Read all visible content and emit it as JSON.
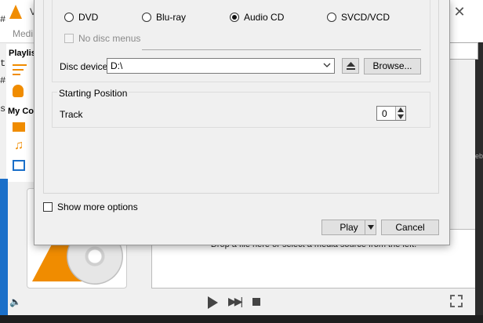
{
  "background_window": {
    "title": "V",
    "menu_text": "Medi",
    "sidebar": {
      "playlist_label": "Playlis",
      "my_computer_label": "My Co"
    },
    "left_edge_text": [
      "#",
      "t",
      "#",
      "s"
    ],
    "drop_hint": "Drop a file here or select a media source from the left.",
    "right_edge_text": "eb"
  },
  "dialog": {
    "disc_selection": {
      "options": [
        {
          "label": "DVD",
          "selected": false
        },
        {
          "label": "Blu-ray",
          "selected": false
        },
        {
          "label": "Audio CD",
          "selected": true
        },
        {
          "label": "SVCD/VCD",
          "selected": false
        }
      ],
      "no_disc_menus_label": "No disc menus",
      "disc_device_label": "Disc device",
      "disc_device_value": "D:\\",
      "browse_label": "Browse..."
    },
    "starting_position": {
      "legend": "Starting Position",
      "track_label": "Track",
      "track_value": "0"
    },
    "show_more_options_label": "Show more options",
    "play_label": "Play",
    "cancel_label": "Cancel"
  },
  "colors": {
    "accent_orange": "#f08c00",
    "taskbar_blue": "#1a6fc9"
  }
}
